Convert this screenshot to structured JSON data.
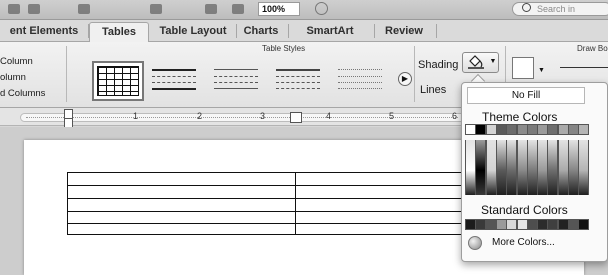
{
  "toolbar": {
    "zoom_value": "100%",
    "search_placeholder": "Search in"
  },
  "tabs": [
    {
      "label": "ent Elements"
    },
    {
      "label": "Tables"
    },
    {
      "label": "Table Layout"
    },
    {
      "label": "Charts"
    },
    {
      "label": "SmartArt"
    },
    {
      "label": "Review"
    }
  ],
  "active_tab": "Tables",
  "ribbon": {
    "left_options": [
      "Column",
      "olumn",
      "d Columns"
    ],
    "table_styles_label": "Table Styles",
    "shading_label": "Shading",
    "lines_label": "Lines",
    "draw_borders_label": "Draw Bo"
  },
  "ruler": {
    "numbers": [
      "1",
      "2",
      "3",
      "4",
      "5",
      "6"
    ]
  },
  "popup": {
    "no_fill": "No Fill",
    "theme_colors_heading": "Theme Colors",
    "standard_colors_heading": "Standard Colors",
    "more_colors": "More Colors..."
  },
  "colors": {
    "theme_top": [
      "#ffffff",
      "#000000",
      "#d3d3d3",
      "#5a5a5a",
      "#6b6b6b",
      "#8a8a8a",
      "#7a7a7a",
      "#9a9a9a",
      "#6e6e6e",
      "#aaaaaa",
      "#858585",
      "#b5b5b5"
    ],
    "standard": [
      "#1c1c1c",
      "#3a3a3a",
      "#555555",
      "#9a9a9a",
      "#d9d9d9",
      "#e6e6e6",
      "#4e4e4e",
      "#2c2c2c",
      "#3f3f3f",
      "#222222",
      "#555555",
      "#111111"
    ]
  }
}
